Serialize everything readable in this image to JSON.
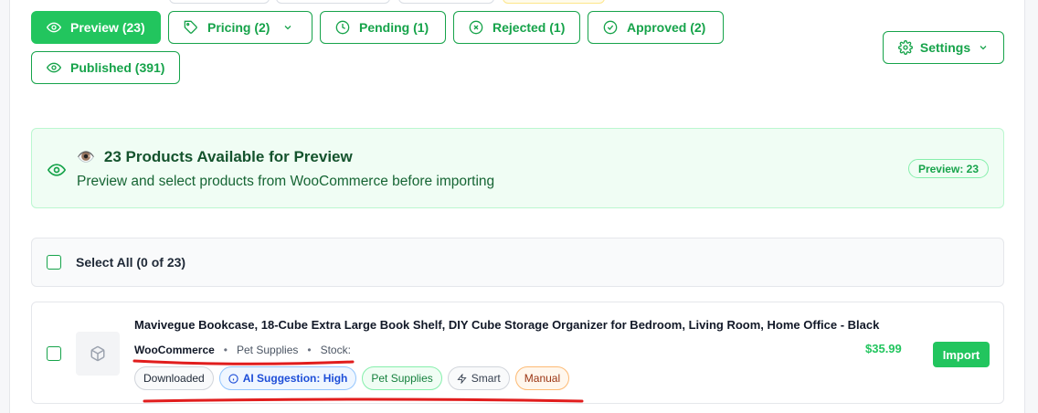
{
  "tabs": [
    {
      "label": "Preview (23)",
      "icon": "eye-icon",
      "active": true
    },
    {
      "label": "Pricing (2)",
      "icon": "tag-icon",
      "dropdown": true
    },
    {
      "label": "Pending (1)",
      "icon": "clock-icon"
    },
    {
      "label": "Rejected (1)",
      "icon": "x-circle-icon"
    },
    {
      "label": "Approved (2)",
      "icon": "check-circle-icon"
    },
    {
      "label": "Published (391)",
      "icon": "eye-icon"
    }
  ],
  "settings": {
    "label": "Settings"
  },
  "banner": {
    "emoji": "👁️",
    "title": "23 Products Available for Preview",
    "subtitle": "Preview and select products from WooCommerce before importing",
    "pill": "Preview: 23"
  },
  "select_all": {
    "label": "Select All (0 of 23)"
  },
  "product": {
    "title": "Mavivegue Bookcase, 18-Cube Extra Large Book Shelf, DIY Cube Storage Organizer for Bedroom, Living Room, Home Office - Black",
    "source": "WooCommerce",
    "category": "Pet Supplies",
    "stock": "Stock:",
    "price": "$35.99",
    "import_label": "Import",
    "badges": {
      "downloaded": "Downloaded",
      "ai": "AI Suggestion: High",
      "category": "Pet Supplies",
      "smart": "Smart",
      "manual": "Manual"
    }
  },
  "colors": {
    "accent": "#22c55e",
    "annotation": "#e11d1d"
  }
}
